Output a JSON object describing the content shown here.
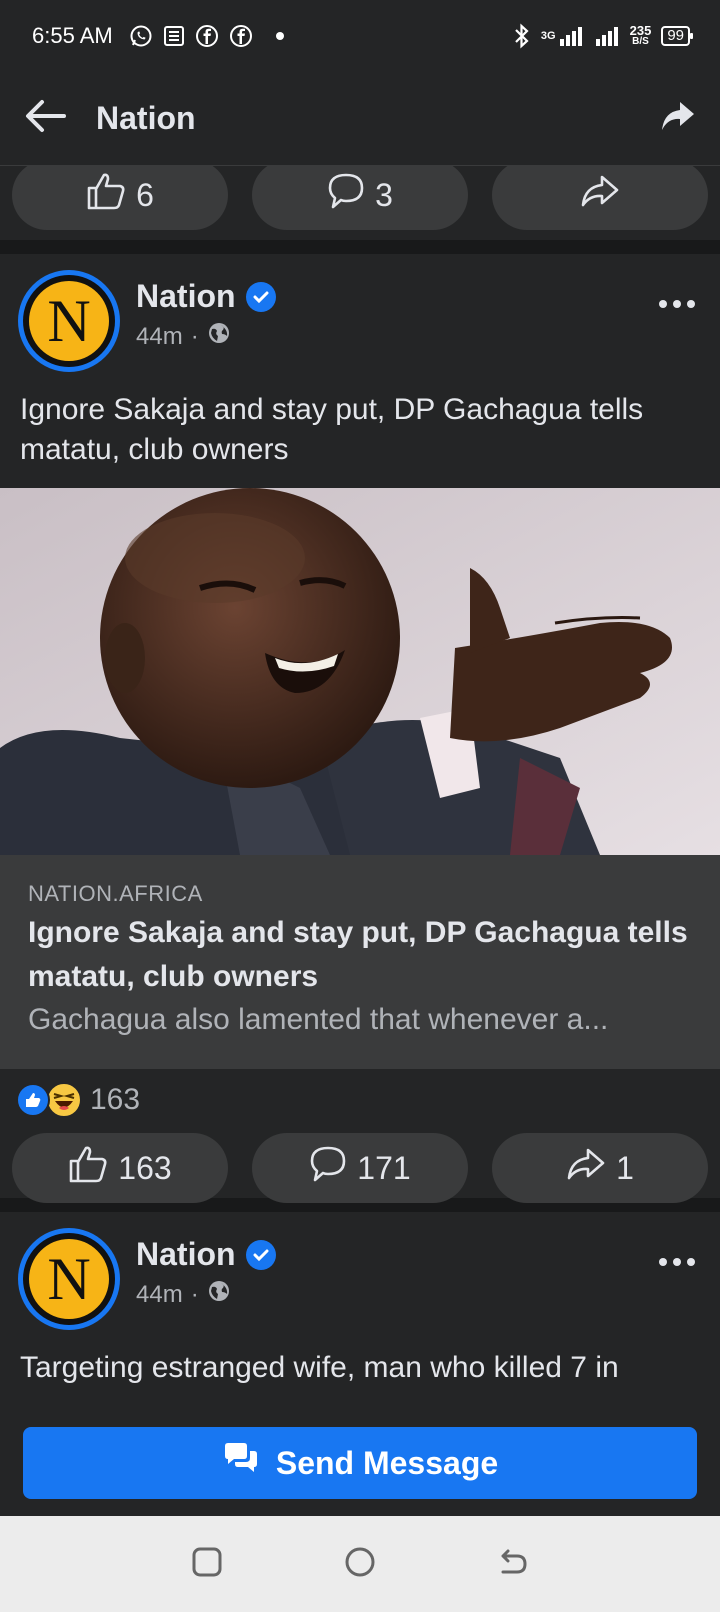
{
  "status_bar": {
    "time": "6:55 AM",
    "network": "3G",
    "speed_value": "235",
    "speed_unit": "B/S",
    "battery": "99"
  },
  "app_bar": {
    "title": "Nation"
  },
  "prev_post": {
    "likes": "6",
    "comments": "3"
  },
  "post1": {
    "author": "Nation",
    "time": "44m",
    "text": "Ignore Sakaja and stay put, DP Gachagua tells matatu, club owners",
    "link": {
      "domain": "NATION.AFRICA",
      "title": "Ignore Sakaja and stay put, DP Gachagua tells matatu, club owners",
      "description": "Gachagua also lamented that whenever a..."
    },
    "reaction_count": "163",
    "likes": "163",
    "comments": "171",
    "shares": "1"
  },
  "post2": {
    "author": "Nation",
    "time": "44m",
    "text": "Targeting estranged wife, man who killed 7 in"
  },
  "send_message": {
    "label": "Send Message"
  },
  "colors": {
    "accent": "#1877f2",
    "background": "#18191a",
    "card": "#242526",
    "pill": "#3a3b3c",
    "avatar_yellow": "#f7b416"
  }
}
